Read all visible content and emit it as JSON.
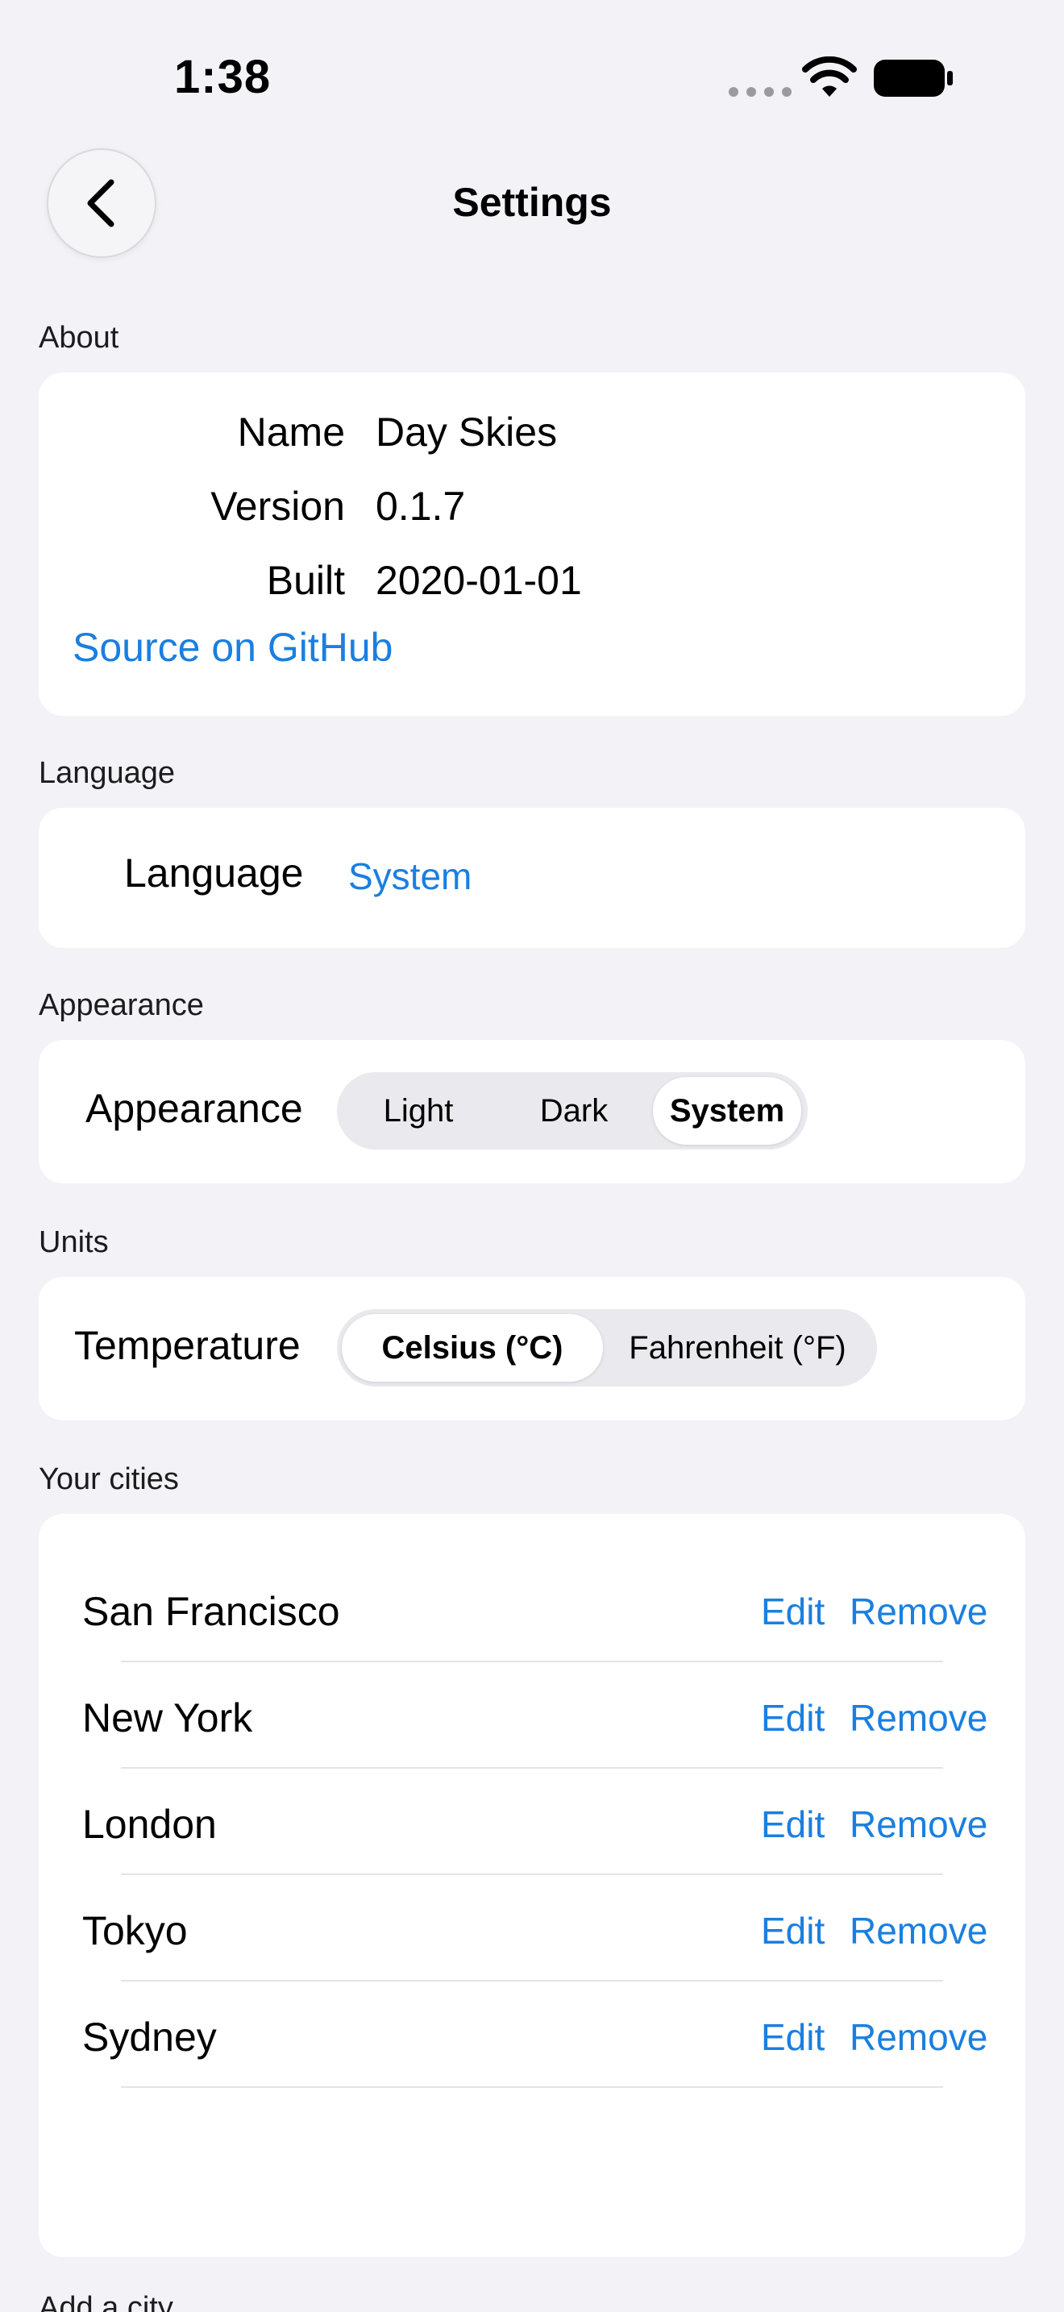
{
  "status_bar": {
    "time": "1:38"
  },
  "nav": {
    "title": "Settings"
  },
  "about": {
    "header": "About",
    "rows": [
      {
        "label": "Name",
        "value": "Day Skies"
      },
      {
        "label": "Version",
        "value": "0.1.7"
      },
      {
        "label": "Built",
        "value": "2020-01-01"
      }
    ],
    "link": "Source on GitHub"
  },
  "language": {
    "header": "Language",
    "label": "Language",
    "value": "System"
  },
  "appearance": {
    "header": "Appearance",
    "label": "Appearance",
    "options": [
      "Light",
      "Dark",
      "System"
    ],
    "selected": "System"
  },
  "units": {
    "header": "Units",
    "label": "Temperature",
    "options": [
      "Celsius (°C)",
      "Fahrenheit (°F)"
    ],
    "selected": "Celsius (°C)"
  },
  "cities": {
    "header": "Your cities",
    "edit_label": "Edit",
    "remove_label": "Remove",
    "items": [
      "San Francisco",
      "New York",
      "London",
      "Tokyo",
      "Sydney"
    ]
  },
  "add_city": {
    "header": "Add a city"
  },
  "colors": {
    "accent": "#1a7fe0",
    "background": "#f2f2f7",
    "card": "#ffffff"
  }
}
